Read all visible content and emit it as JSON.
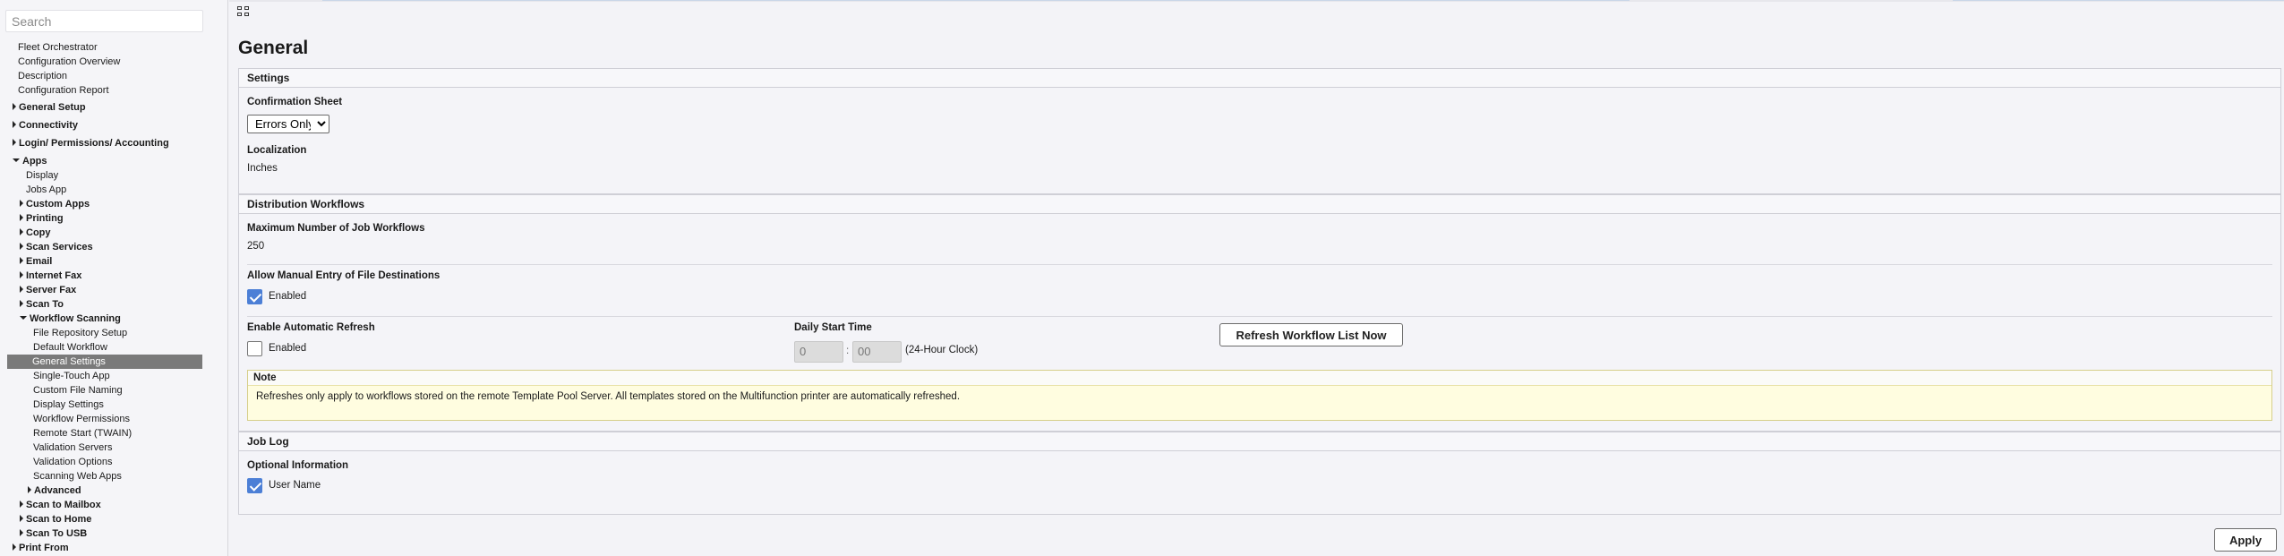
{
  "sidebar": {
    "search_placeholder": "Search",
    "items": [
      {
        "label": "Fleet Orchestrator"
      },
      {
        "label": "Configuration Overview"
      },
      {
        "label": "Description"
      },
      {
        "label": "Configuration Report"
      },
      {
        "label": "General Setup"
      },
      {
        "label": "Connectivity"
      },
      {
        "label": "Login/ Permissions/ Accounting"
      },
      {
        "label": "Apps"
      },
      {
        "label": "Display"
      },
      {
        "label": "Jobs App"
      },
      {
        "label": "Custom Apps"
      },
      {
        "label": "Printing"
      },
      {
        "label": "Copy"
      },
      {
        "label": "Scan Services"
      },
      {
        "label": "Email"
      },
      {
        "label": "Internet Fax"
      },
      {
        "label": "Server Fax"
      },
      {
        "label": "Scan To"
      },
      {
        "label": "Workflow Scanning"
      },
      {
        "label": "File Repository Setup"
      },
      {
        "label": "Default Workflow"
      },
      {
        "label": "General Settings"
      },
      {
        "label": "Single-Touch App"
      },
      {
        "label": "Custom File Naming"
      },
      {
        "label": "Display Settings"
      },
      {
        "label": "Workflow Permissions"
      },
      {
        "label": "Remote Start (TWAIN)"
      },
      {
        "label": "Validation Servers"
      },
      {
        "label": "Validation Options"
      },
      {
        "label": "Scanning Web Apps"
      },
      {
        "label": "Advanced"
      },
      {
        "label": "Scan to Mailbox"
      },
      {
        "label": "Scan to Home"
      },
      {
        "label": "Scan To USB"
      },
      {
        "label": "Print From"
      }
    ]
  },
  "page": {
    "title": "General"
  },
  "settings": {
    "header": "Settings",
    "confirmation_label": "Confirmation Sheet",
    "confirmation_value": "Errors Only",
    "confirmation_options": [
      "Errors Only"
    ],
    "localization_label": "Localization",
    "localization_value": "Inches"
  },
  "distribution": {
    "header": "Distribution Workflows",
    "max_label": "Maximum Number of Job Workflows",
    "max_value": "250",
    "manual_entry_label": "Allow Manual Entry of File Destinations",
    "manual_entry_checkbox_label": "Enabled",
    "manual_entry_checked": true,
    "auto_refresh_label": "Enable Automatic Refresh",
    "auto_refresh_checkbox_label": "Enabled",
    "auto_refresh_checked": false,
    "daily_start_label": "Daily Start Time",
    "hour_value": "0",
    "minute_value": "00",
    "time_separator": ":",
    "clock_hint": "(24-Hour Clock)",
    "refresh_button": "Refresh Workflow List Now",
    "note_header": "Note",
    "note_text": "Refreshes only apply to workflows stored on the remote Template Pool Server. All templates stored on the Multifunction printer are automatically refreshed."
  },
  "job_log": {
    "header": "Job Log",
    "optional_label": "Optional Information",
    "user_name_label": "User Name",
    "user_name_checked": true
  },
  "footer": {
    "apply_button": "Apply"
  },
  "colors": {
    "accent": "#4c7fd6",
    "selected_nav": "#7a7a7a",
    "note_bg": "#fffde0"
  }
}
